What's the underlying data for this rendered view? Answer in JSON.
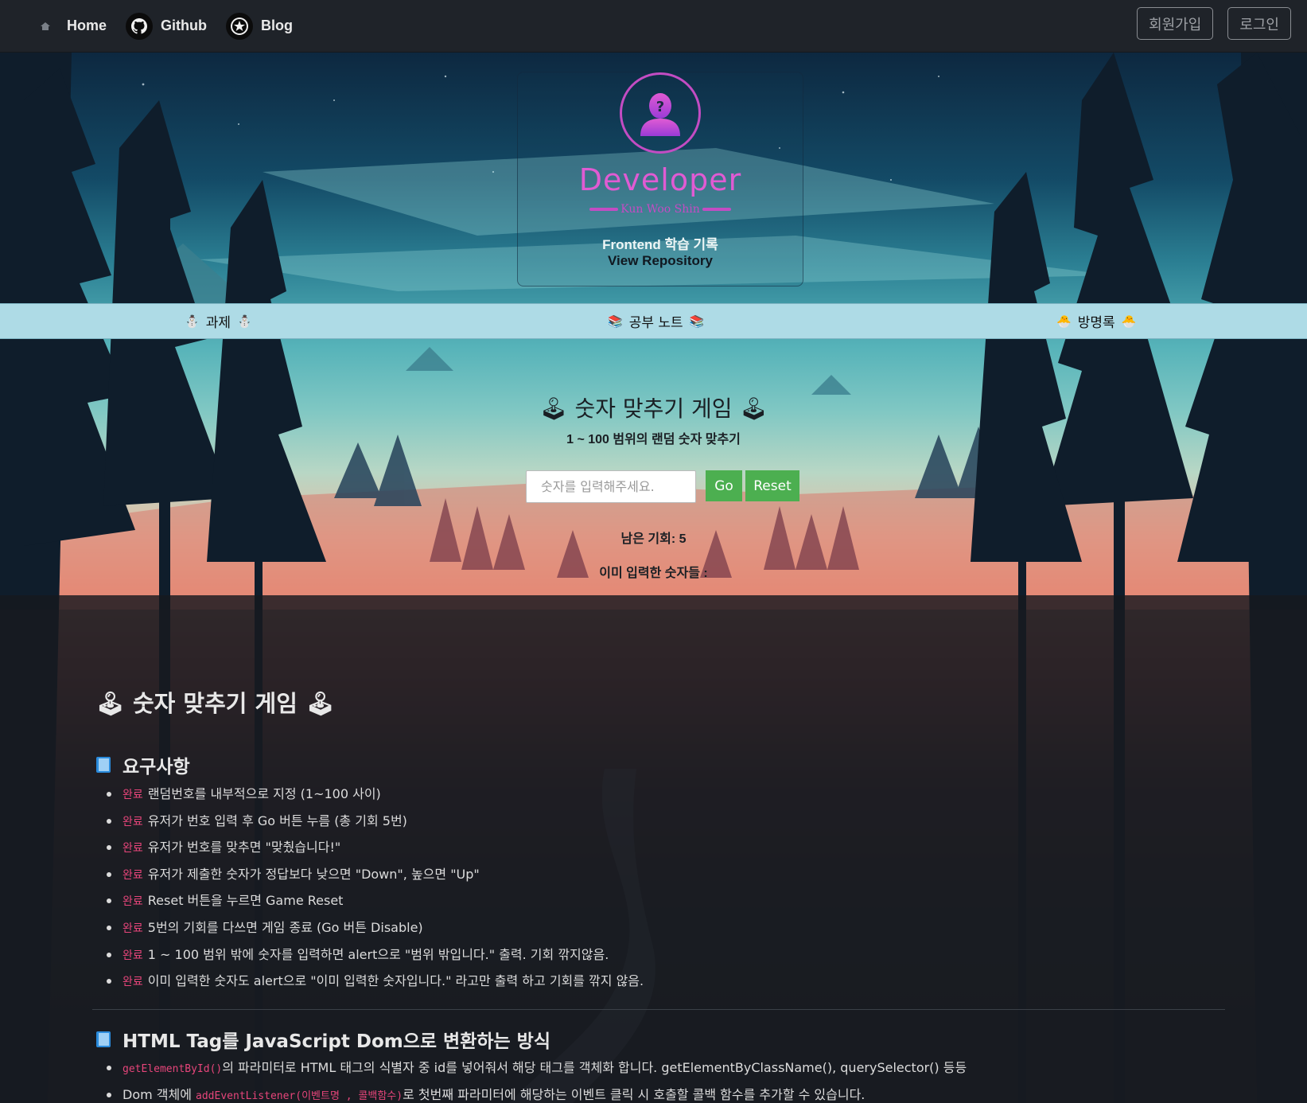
{
  "nav": {
    "home": "Home",
    "github": "Github",
    "blog": "Blog",
    "signup": "회원가입",
    "login": "로그인"
  },
  "profile": {
    "title": "Developer",
    "name": "Kun Woo Shin",
    "desc": "Frontend 학습 기록",
    "repo": "View Repository"
  },
  "tabs": [
    {
      "label": "과제",
      "emoji": "⛄"
    },
    {
      "label": "공부 노트",
      "emoji": "📚"
    },
    {
      "label": "방명록",
      "emoji": "🐣"
    }
  ],
  "game": {
    "title": "숫자 맞추기 게임",
    "emoji": "🕹",
    "subtitle": "1 ~ 100 범위의 랜덤 숫자 맞추기",
    "input_placeholder": "숫자를 입력해주세요.",
    "go": "Go",
    "reset": "Reset",
    "chance_label": "남은 기회: 5",
    "entered_label": "이미 입력한 숫자들 :"
  },
  "readme": {
    "title": "숫자 맞추기 게임",
    "sections": [
      {
        "heading": "요구사항",
        "status": "완료",
        "items": [
          "랜덤번호를 내부적으로 지정 (1~100 사이)",
          "유저가 번호 입력 후 Go 버튼 누름 (총 기회 5번)",
          "유저가 번호를 맞추면 \"맞췄습니다!\"",
          "유저가 제출한 숫자가 정답보다 낮으면 \"Down\", 높으면 \"Up\"",
          "Reset 버튼을 누르면 Game Reset",
          "5번의 기회를 다쓰면 게임 종료 (Go 버튼 Disable)",
          "1 ~ 100 범위 밖에 숫자를 입력하면 alert으로 \"범위 밖입니다.\" 출력. 기회 깎지않음.",
          "이미 입력한 숫자도 alert으로 \"이미 입력한 숫자입니다.\" 라고만 출력 하고 기회를 깎지 않음."
        ]
      },
      {
        "heading": "HTML Tag를 JavaScript Dom으로 변환하는 방식",
        "items": [
          {
            "code": "getElementById()",
            "text": "의 파라미터로 HTML 태그의 식별자 중 id를 넣어줘서 해당 태그를 객체화 합니다. getElementByClassName(), querySelector() 등등"
          },
          {
            "prefix": "Dom 객체에 ",
            "code": "addEventListener(이벤트명 , 콜백함수)",
            "text": "로 첫번째 파라미터에 해당하는 이벤트 클릭 시 호출할 콜백 함수를 추가할 수 있습니다."
          }
        ]
      }
    ]
  },
  "colors": {
    "accent_pink": "#c34cc3",
    "done_pink": "#e6457a",
    "green_button": "#4caf50",
    "tabbar": "#aedbe6",
    "navbar": "#1f2329"
  }
}
